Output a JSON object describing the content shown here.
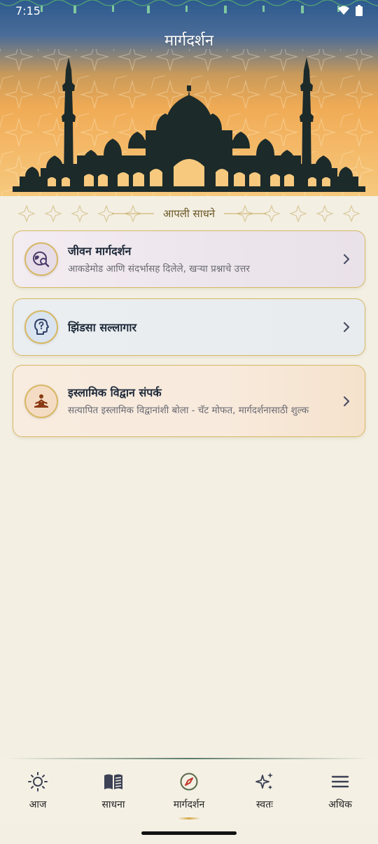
{
  "status_bar": {
    "time": "7:15"
  },
  "header": {
    "title": "मार्गदर्शन"
  },
  "section": {
    "label": "आपली साधने"
  },
  "cards": [
    {
      "title": "जीवन मार्गदर्शन",
      "subtitle": "आकडेमोड आणि संदर्भासह दिलेले, खऱ्या प्रश्नाचे उत्तर",
      "icon": "globe-search-icon"
    },
    {
      "title": "झिंडसा सल्लागार",
      "subtitle": "",
      "icon": "head-question-icon"
    },
    {
      "title": "इस्लामिक विद्वान संपर्क",
      "subtitle": "सत्यापित इस्लामिक विद्वानांशी बोला - चॅट मोफत, मार्गदर्शनासाठी शुल्क",
      "icon": "meditation-person-icon"
    }
  ],
  "nav": {
    "items": [
      {
        "label": "आज",
        "icon": "sun-icon"
      },
      {
        "label": "साधना",
        "icon": "book-icon"
      },
      {
        "label": "मार्गदर्शन",
        "icon": "compass-icon",
        "active": true
      },
      {
        "label": "स्वतः",
        "icon": "sparkles-icon"
      },
      {
        "label": "अधिक",
        "icon": "menu-icon"
      }
    ]
  },
  "colors": {
    "accent_gold": "#d8b865",
    "background": "#f3efe3",
    "title_text": "#1f2a3a"
  }
}
